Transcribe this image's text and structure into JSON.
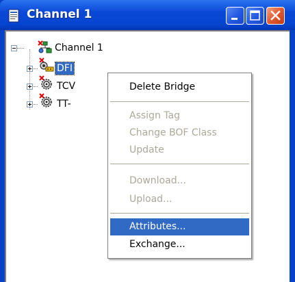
{
  "window": {
    "title": "Channel 1"
  },
  "tree": {
    "root": {
      "label": "Channel 1"
    },
    "children": [
      {
        "label": "DFI",
        "selected": true
      },
      {
        "label": "TCV"
      },
      {
        "label": "TT-"
      }
    ]
  },
  "context_menu": {
    "items": [
      {
        "label": "Delete Bridge"
      },
      {
        "label": "Assign Tag"
      },
      {
        "label": "Change BOF Class"
      },
      {
        "label": "Update"
      },
      {
        "label": "Download..."
      },
      {
        "label": "Upload..."
      },
      {
        "label": "Attributes..."
      },
      {
        "label": "Exchange..."
      }
    ]
  },
  "colors": {
    "titlebar": "#0a48d6",
    "selection": "#316ac5",
    "disabled_text": "#aca899",
    "error_mark": "#e00000"
  },
  "icons": {
    "title": "document-window-icon",
    "root": "network-tree-icon",
    "dfi": "bridge-device-icon",
    "tcv": "gear-device-icon",
    "tt": "gear-device-icon"
  }
}
